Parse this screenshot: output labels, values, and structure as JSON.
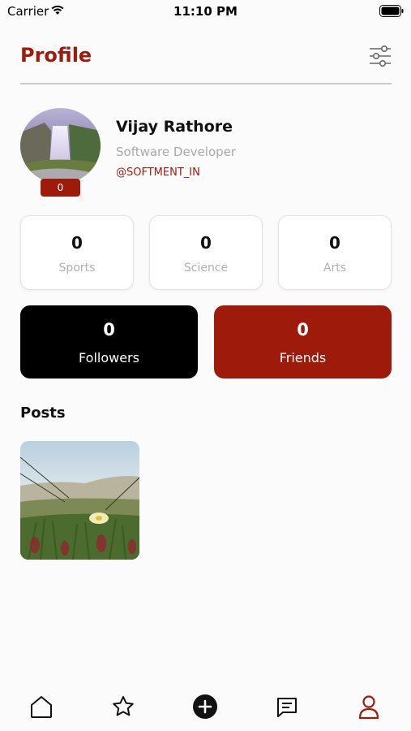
{
  "status_bar": {
    "carrier": "Carrier",
    "time": "11:10 PM"
  },
  "header": {
    "title": "Profile"
  },
  "profile": {
    "name": "Vijay Rathore",
    "role": "Software Developer",
    "handle": "@SOFTMENT_IN",
    "badge_count": "0"
  },
  "categories": [
    {
      "count": "0",
      "label": "Sports"
    },
    {
      "count": "0",
      "label": "Science"
    },
    {
      "count": "0",
      "label": "Arts"
    }
  ],
  "social": {
    "followers": {
      "count": "0",
      "label": "Followers"
    },
    "friends": {
      "count": "0",
      "label": "Friends"
    }
  },
  "posts": {
    "title": "Posts"
  },
  "tab_bar": {
    "items": [
      {
        "icon": "home-icon"
      },
      {
        "icon": "star-icon"
      },
      {
        "icon": "add-icon"
      },
      {
        "icon": "chat-icon"
      },
      {
        "icon": "profile-icon",
        "active": true
      }
    ]
  },
  "colors": {
    "accent": "#9e1b0c",
    "dark": "#000000",
    "muted": "#a9a9a9"
  }
}
